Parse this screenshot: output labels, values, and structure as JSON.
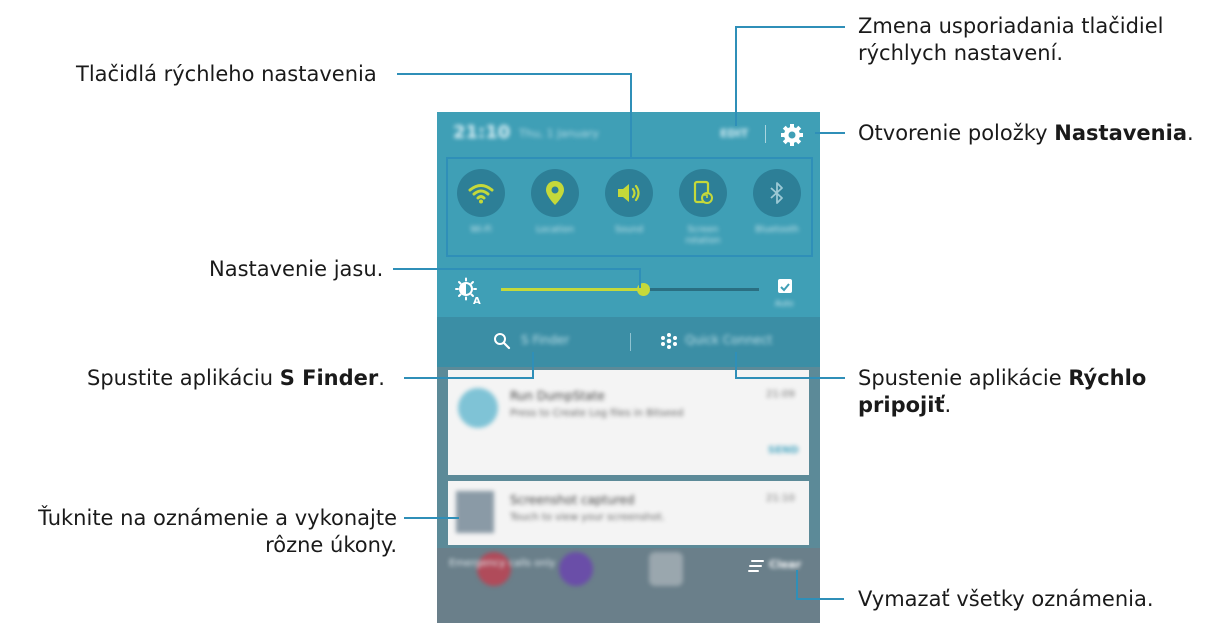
{
  "labels": {
    "quick_buttons": "Tlačidlá rýchleho nastavenia",
    "rearrange_line1": "Zmena usporiadania tlačidiel",
    "rearrange_line2": "rýchlych nastavení.",
    "settings_prefix": "Otvorenie položky ",
    "settings_bold": "Nastavenia",
    "settings_suffix": ".",
    "brightness": "Nastavenie jasu.",
    "sfinder_prefix": "Spustite aplikáciu ",
    "sfinder_bold": "S Finder",
    "sfinder_suffix": ".",
    "quick_connect_prefix": "Spustenie aplikácie ",
    "quick_connect_bold_line1": "Rýchlo",
    "quick_connect_bold_line2": "pripojiť",
    "quick_connect_suffix": ".",
    "notification_line1": "Ťuknite na oznámenie a vykonajte",
    "notification_line2": "rôzne úkony.",
    "clear_all": "Vymazať všetky oznámenia."
  },
  "phone": {
    "status": {
      "time": "21:10",
      "date": "Thu, 1 January",
      "edit": "EDIT"
    },
    "quick_settings": [
      {
        "label": "Wi-Fi",
        "icon": "wifi-icon",
        "active": true
      },
      {
        "label": "Location",
        "icon": "location-pin-icon",
        "active": true
      },
      {
        "label": "Sound",
        "icon": "speaker-icon",
        "active": true
      },
      {
        "label": "Screen rotation",
        "icon": "screen-rotation-icon",
        "active": true
      },
      {
        "label": "Bluetooth",
        "icon": "bluetooth-icon",
        "active": false
      }
    ],
    "brightness": {
      "level": 0.55,
      "auto_label": "Auto",
      "auto_checked": true
    },
    "finder_bar": {
      "s_finder": "S Finder",
      "quick_connect": "Quick Connect"
    },
    "notifications": [
      {
        "title": "Run DumpState",
        "text": "Press to Create Log files in Bitseed",
        "time": "21:09",
        "action": "SEND"
      },
      {
        "title": "Screenshot captured",
        "text": "Touch to view your screenshot.",
        "time": "21:10"
      }
    ],
    "bottom": {
      "emergency": "Emergency calls only",
      "clear": "Clear"
    }
  },
  "colors": {
    "accent": "#2f8fb8",
    "active": "#c5d93a",
    "panel": "#3f9fb6"
  }
}
